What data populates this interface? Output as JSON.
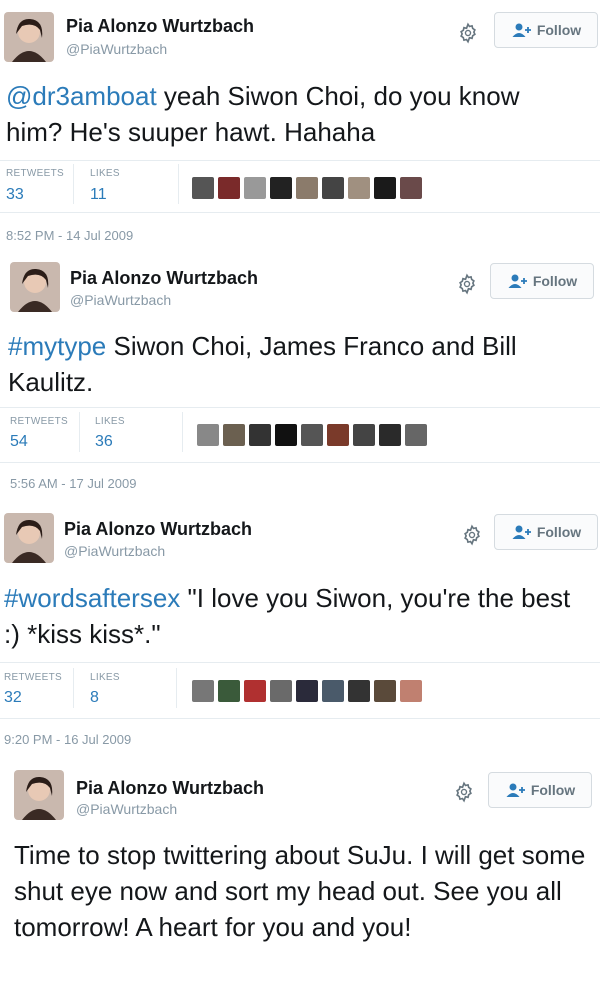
{
  "tweets": [
    {
      "name": "Pia Alonzo Wurtzbach",
      "handle": "@PiaWurtzbach",
      "follow_label": "Follow",
      "mention": "@dr3amboat",
      "text_rest": " yeah Siwon Choi, do you know him? He's suuper hawt. Hahaha",
      "retweets_label": "RETWEETS",
      "retweets": "33",
      "likes_label": "LIKES",
      "likes": "11",
      "timestamp": "8:52 PM - 14 Jul 2009"
    },
    {
      "name": "Pia Alonzo Wurtzbach",
      "handle": "@PiaWurtzbach",
      "follow_label": "Follow",
      "hashtag": "#mytype",
      "text_rest": " Siwon Choi, James Franco and Bill Kaulitz.",
      "retweets_label": "RETWEETS",
      "retweets": "54",
      "likes_label": "LIKES",
      "likes": "36",
      "timestamp": "5:56 AM - 17 Jul 2009"
    },
    {
      "name": "Pia Alonzo Wurtzbach",
      "handle": "@PiaWurtzbach",
      "follow_label": "Follow",
      "hashtag": "#wordsaftersex",
      "text_rest": " \"I love you Siwon, you're the best :) *kiss kiss*.\"",
      "retweets_label": "RETWEETS",
      "retweets": "32",
      "likes_label": "LIKES",
      "likes": "8",
      "timestamp": "9:20 PM - 16 Jul 2009"
    },
    {
      "name": "Pia Alonzo Wurtzbach",
      "handle": "@PiaWurtzbach",
      "follow_label": "Follow",
      "text": "Time to stop twittering about SuJu. I will get some shut eye now and sort my head out. See you all tomorrow! A heart for you and you!"
    }
  ],
  "colors": {
    "link": "#2b7bb9",
    "muted": "#8899a6",
    "text": "#14171a",
    "border": "#e6ecf0"
  },
  "icons": [
    "gear-icon",
    "follow-person-plus-icon",
    "avatar"
  ]
}
